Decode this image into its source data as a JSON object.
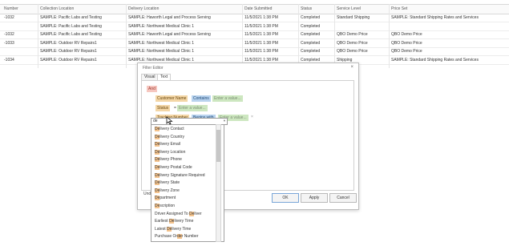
{
  "grid": {
    "headers": [
      "Number",
      "Collection Location",
      "Delivery Location",
      "Date Submitted",
      "Status",
      "Service Level",
      "Price Set"
    ],
    "rows": [
      {
        "number": "-1032",
        "collection": "SAMPLE: Pacific Labs and Testing",
        "delivery": "SAMPLE: Haworth Legal and Process Serving",
        "date": "11/5/2021 1:38 PM",
        "status": "Completed",
        "service": "Standard Shipping",
        "price": "SAMPLE: Standard Shipping Rates and Services"
      },
      {
        "number": "",
        "collection": "SAMPLE: Pacific Labs and Testing",
        "delivery": "SAMPLE: Northwest Medical Clinic 1",
        "date": "11/5/2021 1:38 PM",
        "status": "Completed",
        "service": "",
        "price": ""
      },
      {
        "number": "-1032",
        "collection": "SAMPLE: Pacific Labs and Testing",
        "delivery": "SAMPLE: Haworth Legal and Process Serving",
        "date": "11/5/2021 1:38 PM",
        "status": "Completed",
        "service": "QBO Demo Price",
        "price": "QBO Demo Price"
      },
      {
        "number": "-1033",
        "collection": "SAMPLE: Outdoor RV Repairs1",
        "delivery": "SAMPLE: Northwest Medical Clinic 1",
        "date": "11/5/2021 1:38 PM",
        "status": "Completed",
        "service": "QBO Demo Price",
        "price": "QBO Demo Price"
      },
      {
        "number": "",
        "collection": "SAMPLE: Outdoor RV Repairs1",
        "delivery": "SAMPLE: Northwest Medical Clinic 1",
        "date": "11/5/2021 1:38 PM",
        "status": "Completed",
        "service": "QBO Demo Price",
        "price": "QBO Demo Price"
      },
      {
        "number": "-1034",
        "collection": "SAMPLE: Outdoor RV Repairs1",
        "delivery": "SAMPLE: Northwest Medical Clinic 1",
        "date": "11/5/2021 1:38 PM",
        "status": "Completed",
        "service": "Shipping",
        "price": "SAMPLE: Standard Shipping Rates and Services"
      }
    ]
  },
  "dialog": {
    "title": "Filter Editor",
    "close": "×",
    "tabs": [
      "Visual",
      "Text"
    ],
    "group": "And",
    "conditions": [
      {
        "field": "Customer Name",
        "op": "Contains",
        "value": "Enter a value..."
      },
      {
        "field": "Status",
        "op": "=",
        "value": "Enter a value..."
      },
      {
        "field": "Tracking Number",
        "op": "Begins with",
        "value": "Enter a value..."
      }
    ],
    "remove": "×",
    "dropdown_value": "de",
    "dropdown_items": [
      {
        "pre": "",
        "hl": "De",
        "post": "livery Contact"
      },
      {
        "pre": "",
        "hl": "De",
        "post": "livery Country"
      },
      {
        "pre": "",
        "hl": "De",
        "post": "livery Email"
      },
      {
        "pre": "",
        "hl": "De",
        "post": "livery Location"
      },
      {
        "pre": "",
        "hl": "De",
        "post": "livery Phone"
      },
      {
        "pre": "",
        "hl": "De",
        "post": "livery Postal Code"
      },
      {
        "pre": "",
        "hl": "De",
        "post": "livery Signature Required"
      },
      {
        "pre": "",
        "hl": "De",
        "post": "livery State"
      },
      {
        "pre": "",
        "hl": "De",
        "post": "livery Zone"
      },
      {
        "pre": "",
        "hl": "De",
        "post": "partment"
      },
      {
        "pre": "",
        "hl": "De",
        "post": "scription"
      },
      {
        "pre": "Driver Assigned To ",
        "hl": "De",
        "post": "liver"
      },
      {
        "pre": "Earliest ",
        "hl": "De",
        "post": "livery Time"
      },
      {
        "pre": "Latest ",
        "hl": "De",
        "post": "livery Time"
      },
      {
        "pre": "Purchase Or",
        "hl": "de",
        "post": "r Number"
      }
    ],
    "hidden_button": "Undo",
    "buttons": {
      "ok": "OK",
      "apply": "Apply",
      "cancel": "Cancel"
    }
  }
}
